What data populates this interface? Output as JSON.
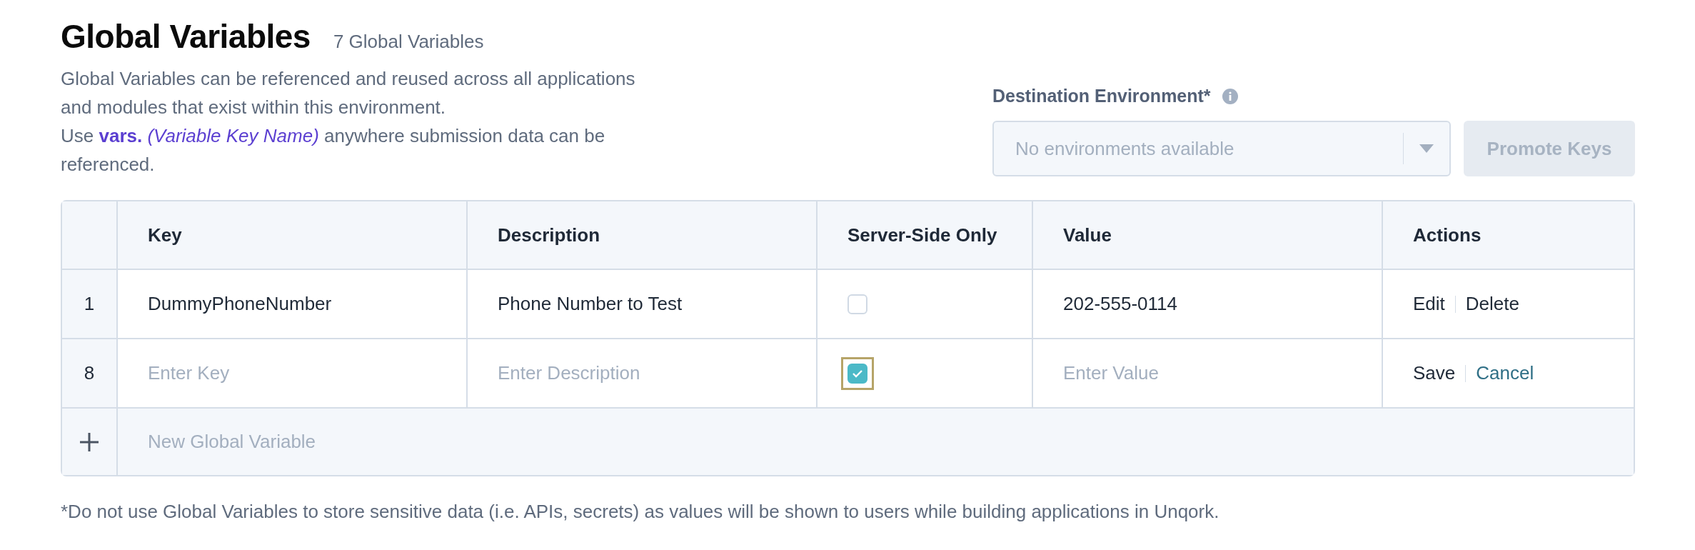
{
  "header": {
    "title": "Global Variables",
    "count": "7 Global Variables",
    "description_lines": [
      "Global Variables can be referenced and reused across all applications",
      "and modules that exist within this environment.",
      "Use **vars.** *(Variable Key Name)* anywhere submission data can be",
      "referenced."
    ]
  },
  "promote": {
    "label": "Destination Environment*",
    "select_placeholder": "No environments available",
    "button": {
      "label": "Promote Keys",
      "disabled": true
    }
  },
  "table": {
    "columns": [
      "Key",
      "Description",
      "Server-Side Only",
      "Value",
      "Actions"
    ],
    "rows": [
      {
        "kind": "saved",
        "index": "1",
        "key": "DummyPhoneNumber",
        "description": "Phone Number to Test",
        "server_side_only": false,
        "focused": false,
        "value": "202-555-0114",
        "actions": [
          {
            "label": "Edit",
            "kind": "plain"
          },
          {
            "label": "Delete",
            "kind": "plain"
          }
        ]
      },
      {
        "kind": "new",
        "index": "8",
        "key_placeholder": "Enter Key",
        "description_placeholder": "Enter Description",
        "server_side_only": true,
        "focused": true,
        "value_placeholder": "Enter Value",
        "actions": [
          {
            "label": "Save",
            "kind": "plain"
          },
          {
            "label": "Cancel",
            "kind": "accent"
          }
        ]
      }
    ],
    "add_row": {
      "label": "New Global Variable"
    }
  },
  "footnote": "*Do not use Global Variables to store sensitive data (i.e. APIs, secrets) as values will be shown to users while building applications in Unqork."
}
